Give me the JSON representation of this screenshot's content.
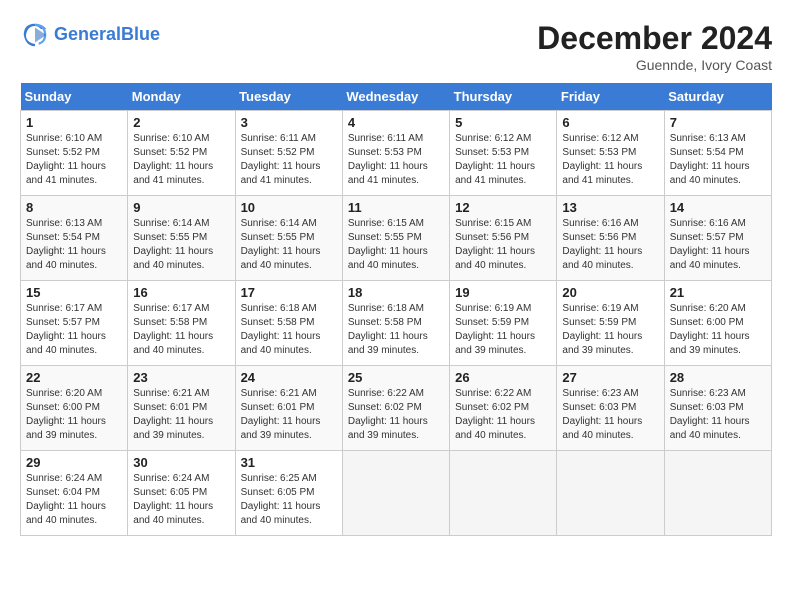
{
  "header": {
    "logo_line1": "General",
    "logo_line2": "Blue",
    "month_title": "December 2024",
    "location": "Guennde, Ivory Coast"
  },
  "days_of_week": [
    "Sunday",
    "Monday",
    "Tuesday",
    "Wednesday",
    "Thursday",
    "Friday",
    "Saturday"
  ],
  "weeks": [
    [
      {
        "day": "1",
        "sunrise": "6:10 AM",
        "sunset": "5:52 PM",
        "daylight": "11 hours and 41 minutes."
      },
      {
        "day": "2",
        "sunrise": "6:10 AM",
        "sunset": "5:52 PM",
        "daylight": "11 hours and 41 minutes."
      },
      {
        "day": "3",
        "sunrise": "6:11 AM",
        "sunset": "5:52 PM",
        "daylight": "11 hours and 41 minutes."
      },
      {
        "day": "4",
        "sunrise": "6:11 AM",
        "sunset": "5:53 PM",
        "daylight": "11 hours and 41 minutes."
      },
      {
        "day": "5",
        "sunrise": "6:12 AM",
        "sunset": "5:53 PM",
        "daylight": "11 hours and 41 minutes."
      },
      {
        "day": "6",
        "sunrise": "6:12 AM",
        "sunset": "5:53 PM",
        "daylight": "11 hours and 41 minutes."
      },
      {
        "day": "7",
        "sunrise": "6:13 AM",
        "sunset": "5:54 PM",
        "daylight": "11 hours and 40 minutes."
      }
    ],
    [
      {
        "day": "8",
        "sunrise": "6:13 AM",
        "sunset": "5:54 PM",
        "daylight": "11 hours and 40 minutes."
      },
      {
        "day": "9",
        "sunrise": "6:14 AM",
        "sunset": "5:55 PM",
        "daylight": "11 hours and 40 minutes."
      },
      {
        "day": "10",
        "sunrise": "6:14 AM",
        "sunset": "5:55 PM",
        "daylight": "11 hours and 40 minutes."
      },
      {
        "day": "11",
        "sunrise": "6:15 AM",
        "sunset": "5:55 PM",
        "daylight": "11 hours and 40 minutes."
      },
      {
        "day": "12",
        "sunrise": "6:15 AM",
        "sunset": "5:56 PM",
        "daylight": "11 hours and 40 minutes."
      },
      {
        "day": "13",
        "sunrise": "6:16 AM",
        "sunset": "5:56 PM",
        "daylight": "11 hours and 40 minutes."
      },
      {
        "day": "14",
        "sunrise": "6:16 AM",
        "sunset": "5:57 PM",
        "daylight": "11 hours and 40 minutes."
      }
    ],
    [
      {
        "day": "15",
        "sunrise": "6:17 AM",
        "sunset": "5:57 PM",
        "daylight": "11 hours and 40 minutes."
      },
      {
        "day": "16",
        "sunrise": "6:17 AM",
        "sunset": "5:58 PM",
        "daylight": "11 hours and 40 minutes."
      },
      {
        "day": "17",
        "sunrise": "6:18 AM",
        "sunset": "5:58 PM",
        "daylight": "11 hours and 40 minutes."
      },
      {
        "day": "18",
        "sunrise": "6:18 AM",
        "sunset": "5:58 PM",
        "daylight": "11 hours and 39 minutes."
      },
      {
        "day": "19",
        "sunrise": "6:19 AM",
        "sunset": "5:59 PM",
        "daylight": "11 hours and 39 minutes."
      },
      {
        "day": "20",
        "sunrise": "6:19 AM",
        "sunset": "5:59 PM",
        "daylight": "11 hours and 39 minutes."
      },
      {
        "day": "21",
        "sunrise": "6:20 AM",
        "sunset": "6:00 PM",
        "daylight": "11 hours and 39 minutes."
      }
    ],
    [
      {
        "day": "22",
        "sunrise": "6:20 AM",
        "sunset": "6:00 PM",
        "daylight": "11 hours and 39 minutes."
      },
      {
        "day": "23",
        "sunrise": "6:21 AM",
        "sunset": "6:01 PM",
        "daylight": "11 hours and 39 minutes."
      },
      {
        "day": "24",
        "sunrise": "6:21 AM",
        "sunset": "6:01 PM",
        "daylight": "11 hours and 39 minutes."
      },
      {
        "day": "25",
        "sunrise": "6:22 AM",
        "sunset": "6:02 PM",
        "daylight": "11 hours and 39 minutes."
      },
      {
        "day": "26",
        "sunrise": "6:22 AM",
        "sunset": "6:02 PM",
        "daylight": "11 hours and 40 minutes."
      },
      {
        "day": "27",
        "sunrise": "6:23 AM",
        "sunset": "6:03 PM",
        "daylight": "11 hours and 40 minutes."
      },
      {
        "day": "28",
        "sunrise": "6:23 AM",
        "sunset": "6:03 PM",
        "daylight": "11 hours and 40 minutes."
      }
    ],
    [
      {
        "day": "29",
        "sunrise": "6:24 AM",
        "sunset": "6:04 PM",
        "daylight": "11 hours and 40 minutes."
      },
      {
        "day": "30",
        "sunrise": "6:24 AM",
        "sunset": "6:05 PM",
        "daylight": "11 hours and 40 minutes."
      },
      {
        "day": "31",
        "sunrise": "6:25 AM",
        "sunset": "6:05 PM",
        "daylight": "11 hours and 40 minutes."
      },
      null,
      null,
      null,
      null
    ]
  ],
  "labels": {
    "sunrise": "Sunrise: ",
    "sunset": "Sunset: ",
    "daylight": "Daylight: "
  }
}
